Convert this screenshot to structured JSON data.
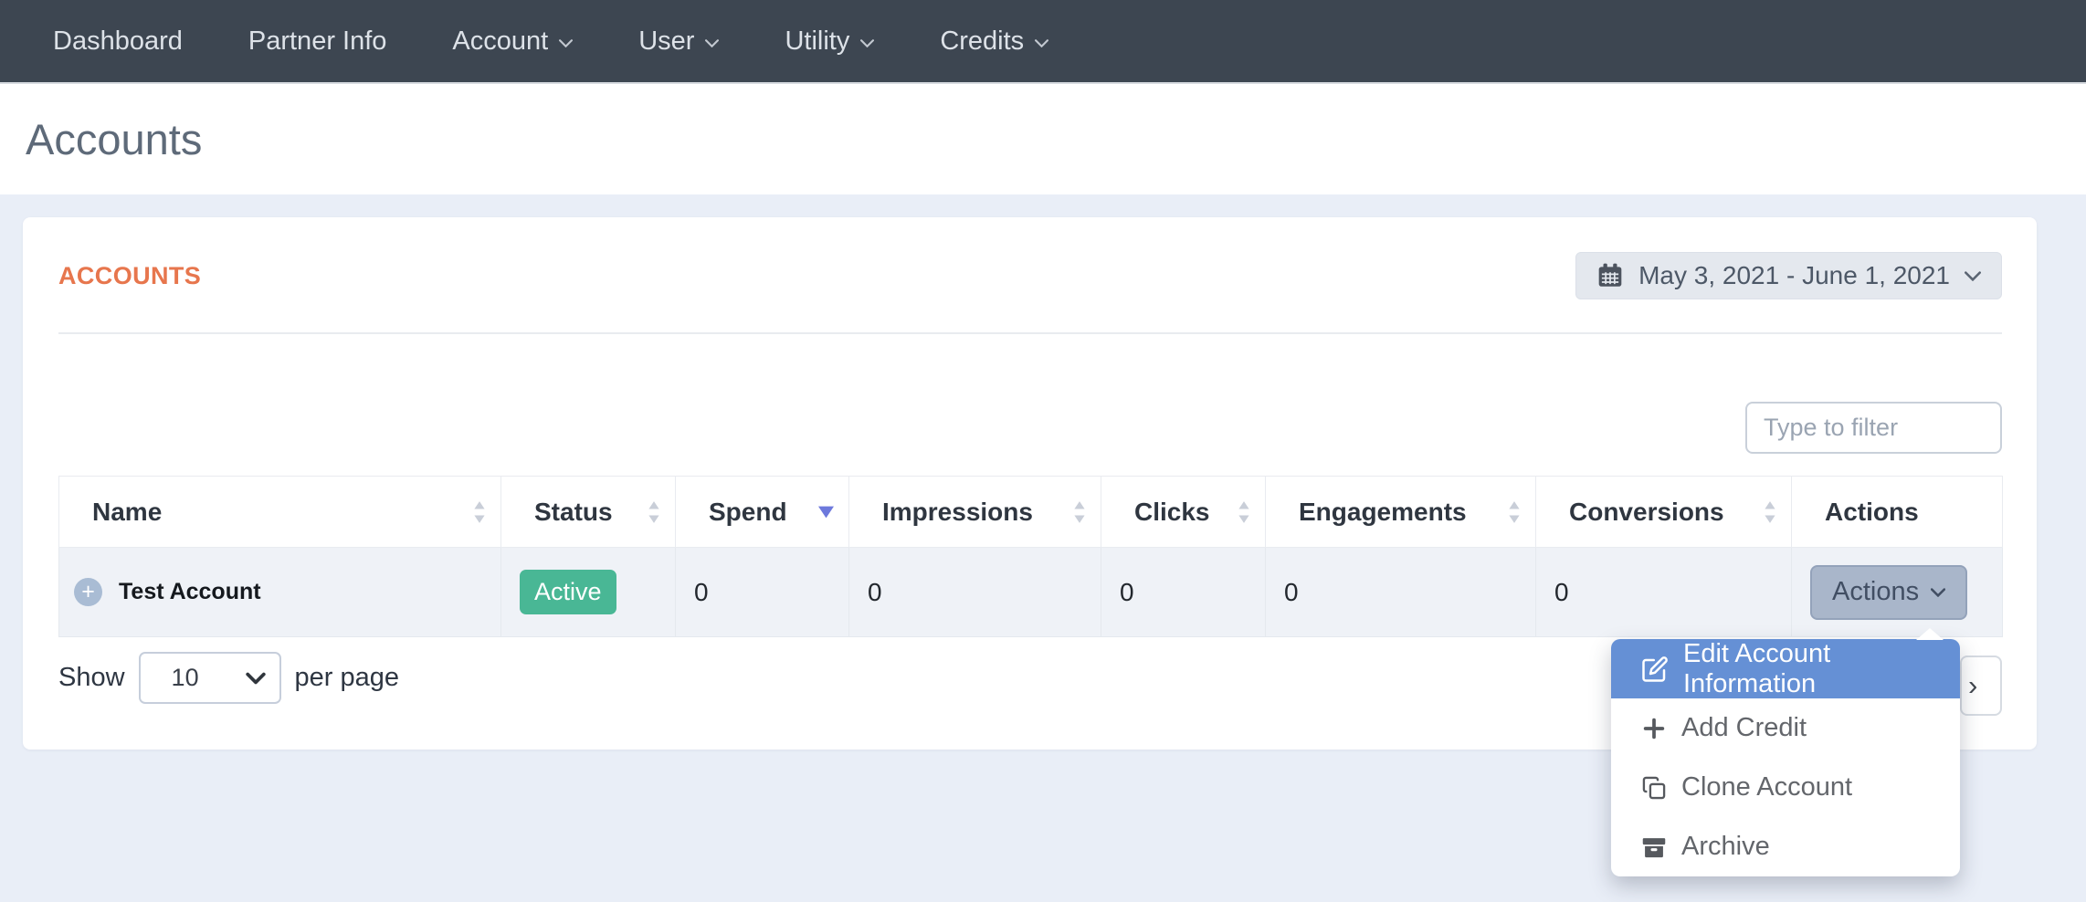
{
  "navbar": {
    "items": [
      {
        "label": "Dashboard",
        "caret": false
      },
      {
        "label": "Partner Info",
        "caret": false
      },
      {
        "label": "Account",
        "caret": true
      },
      {
        "label": "User",
        "caret": true
      },
      {
        "label": "Utility",
        "caret": true
      },
      {
        "label": "Credits",
        "caret": true
      }
    ]
  },
  "page": {
    "title": "Accounts"
  },
  "panel": {
    "title": "ACCOUNTS",
    "date_range": "May 3, 2021 - June 1, 2021",
    "filter_placeholder": "Type to filter"
  },
  "table": {
    "columns": [
      {
        "label": "Name",
        "sortable": true
      },
      {
        "label": "Status",
        "sortable": true
      },
      {
        "label": "Spend",
        "sortable": true,
        "sort": "desc"
      },
      {
        "label": "Impressions",
        "sortable": true
      },
      {
        "label": "Clicks",
        "sortable": true
      },
      {
        "label": "Engagements",
        "sortable": true
      },
      {
        "label": "Conversions",
        "sortable": true
      },
      {
        "label": "Actions",
        "sortable": false
      }
    ],
    "row": {
      "name": "Test Account",
      "status": "Active",
      "spend": "0",
      "impressions": "0",
      "clicks": "0",
      "engagements": "0",
      "conversions": "0",
      "actions": "Actions"
    }
  },
  "footer": {
    "show": "Show",
    "per_page": "10",
    "per_page_suffix": "per page"
  },
  "icons": {
    "expand_glyph": "+",
    "pager_next_glyph": "›"
  },
  "menu": {
    "items": [
      {
        "label": "Edit Account Information",
        "icon": "edit-icon",
        "active": true
      },
      {
        "label": "Add Credit",
        "icon": "plus-icon",
        "active": false
      },
      {
        "label": "Clone Account",
        "icon": "clone-icon",
        "active": false
      },
      {
        "label": "Archive",
        "icon": "archive-icon",
        "active": false
      }
    ]
  },
  "colors": {
    "navbar_bg": "#3d4651",
    "accent_orange": "#e7764d",
    "status_active_green": "#49b795",
    "menu_highlight_blue": "#6590d5",
    "sort_active_indicator": "#6d79dc",
    "page_background": "#e9eef7"
  }
}
